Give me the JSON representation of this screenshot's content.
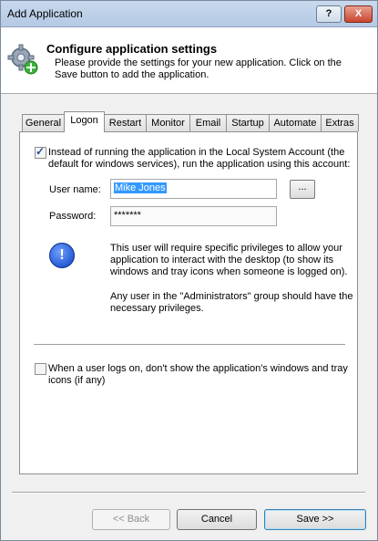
{
  "window": {
    "title": "Add Application",
    "help_label": "?",
    "close_label": "X"
  },
  "header": {
    "title": "Configure application settings",
    "description": "Please provide the settings for your new application. Click on the Save button to add the application."
  },
  "tabs": [
    {
      "label": "General"
    },
    {
      "label": "Logon"
    },
    {
      "label": "Restart"
    },
    {
      "label": "Monitor"
    },
    {
      "label": "Email"
    },
    {
      "label": "Startup"
    },
    {
      "label": "Automate"
    },
    {
      "label": "Extras"
    }
  ],
  "logon": {
    "run_as_checked": true,
    "run_as_label_line1": "Instead of running the application in the Local System Account (the",
    "run_as_label_line2": "default for windows services), run the application using this account:",
    "username_label": "User name:",
    "username_value": "Mike Jones",
    "browse_label": "...",
    "password_label": "Password:",
    "password_value": "*******",
    "info_line1": "This user will require specific privileges to allow your",
    "info_line2": "application to interact with the desktop (to show its",
    "info_line3": "windows and tray icons when someone is logged on).",
    "admin_line1": "Any user in the \"Administrators\" group should have the",
    "admin_line2": "necessary privileges.",
    "hide_checked": false,
    "hide_label_line1": "When a user logs on, don't show the application's windows and tray",
    "hide_label_line2": "icons (if any)"
  },
  "buttons": {
    "back": "<< Back",
    "cancel": "Cancel",
    "save": "Save >>"
  }
}
